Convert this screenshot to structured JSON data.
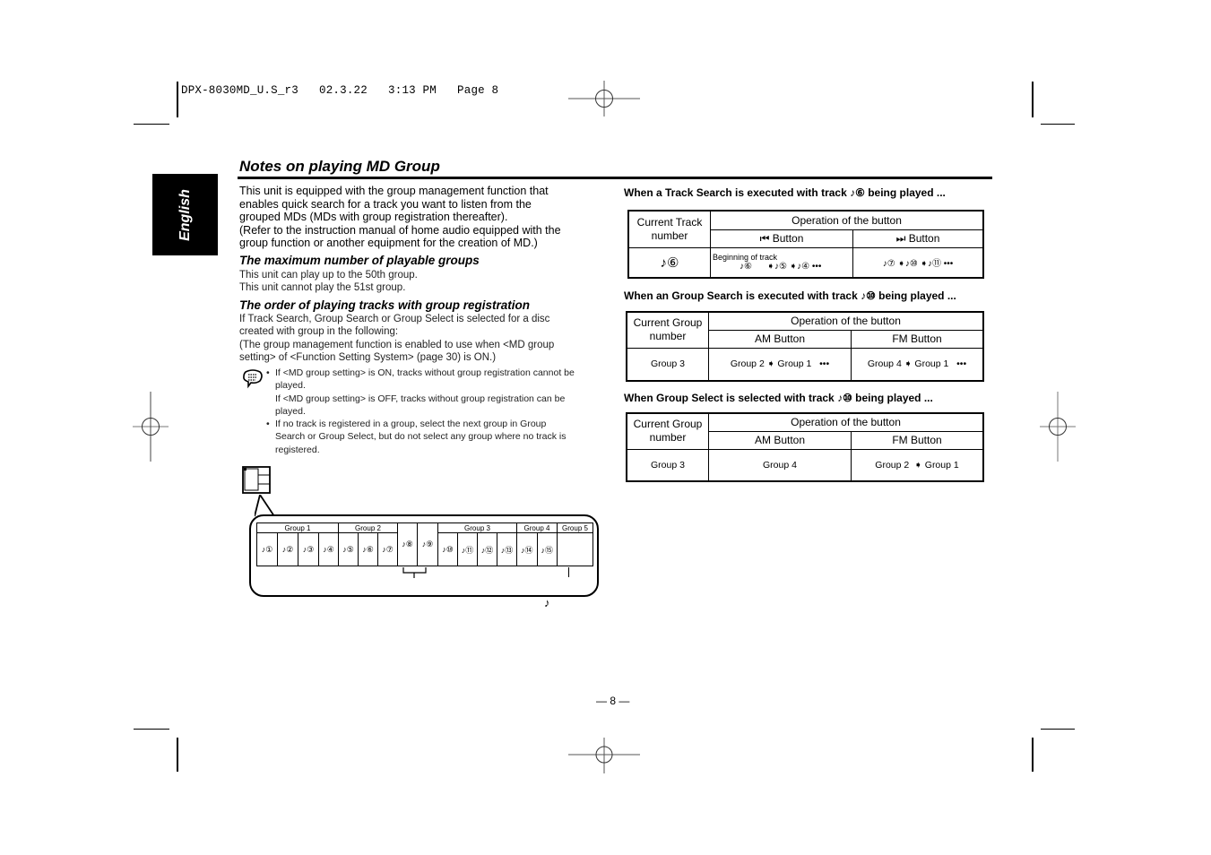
{
  "header": {
    "print_slug": "DPX-8030MD_U.S_r3   02.3.22   3:13 PM   Page 8"
  },
  "language_tab": "English",
  "page_title": "Notes on playing MD Group",
  "intro": {
    "lines": [
      "This unit is equipped with the group management function that",
      "enables quick search for a track you want to listen from the",
      "grouped MDs (MDs with group registration thereafter).",
      "(Refer to the instruction manual of home audio equipped with the",
      "group function or another equipment for the creation of MD.)"
    ]
  },
  "section_max": {
    "heading": "The maximum number of playable groups",
    "lines": [
      "This unit can play up to the 50th group.",
      "This unit cannot play the 51st group."
    ]
  },
  "section_order": {
    "heading": "The order of playing tracks with group registration",
    "lines": [
      "If Track Search, Group Search or Group Select is selected for a disc",
      "created with group in the following:",
      "(The group management function is enabled to use when <MD group",
      "setting> of <Function Setting System> (page 30) is ON.)"
    ],
    "notes": [
      {
        "lines": [
          "If <MD group setting> is ON, tracks without group registration cannot be",
          "played.",
          "If <MD group setting> is OFF, tracks without group registration can be",
          "played."
        ]
      },
      {
        "lines": [
          "If no track is registered in a group, select the next group in Group",
          "Search or Group Select, but do not select any group where no track is",
          "registered."
        ]
      }
    ]
  },
  "diagram": {
    "groups": [
      {
        "label": "Group 1",
        "span": 4
      },
      {
        "label": "Group 2",
        "span": 3
      },
      {
        "label": "",
        "span": 1
      },
      {
        "label": "",
        "span": 1
      },
      {
        "label": "Group 3",
        "span": 4
      },
      {
        "label": "Group 4",
        "span": 2
      },
      {
        "label": "Group 5",
        "span": 1
      }
    ],
    "tracks": [
      "♪①",
      "♪②",
      "♪③",
      "♪④",
      "♪⑤",
      "♪⑥",
      "♪⑦",
      "♪⑧",
      "♪⑨",
      "♪⑩",
      "♪⑪",
      "♪⑫",
      "♪⑬",
      "♪⑭",
      "♪⑮",
      ""
    ],
    "footnote_symbol": "♪"
  },
  "track_search": {
    "heading": "When a Track Search is executed with track ♪⑥ being played ...",
    "col_current": "Current Track number",
    "col_operation": "Operation of the button",
    "btn_prev": "⏮ Button",
    "btn_next": "⏭ Button",
    "current_value": "♪⑥",
    "prev_note": "Beginning of track",
    "prev_value": "♪⑥      ➧♪⑤ ➧♪④ •••",
    "next_value": "♪⑦ ➧♪⑩ ➧♪⑪ •••"
  },
  "group_search": {
    "heading": "When an Group Search is executed with track ♪⑩ being played ...",
    "col_current": "Current Group number",
    "col_operation": "Operation of the button",
    "btn_am": "AM Button",
    "btn_fm": "FM Button",
    "current_value": "Group 3",
    "am_value": "Group 2 ➧ Group 1   •••",
    "fm_value": "Group 4 ➧ Group 1   •••"
  },
  "group_select": {
    "heading": "When Group Select is selected with track ♪⑩ being played ...",
    "col_current": "Current Group number",
    "col_operation": "Operation of the button",
    "btn_am": "AM Button",
    "btn_fm": "FM Button",
    "current_value": "Group 3",
    "am_value": "Group 4",
    "fm_value": "Group 2  ➧ Group 1"
  },
  "page_number": "— 8 —"
}
